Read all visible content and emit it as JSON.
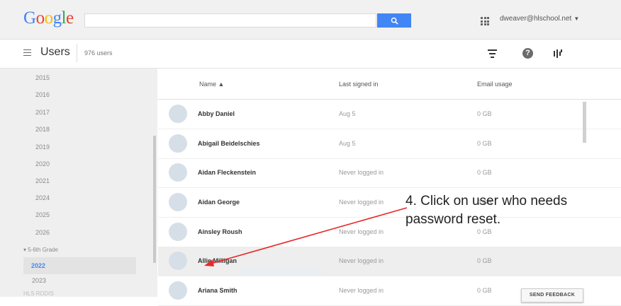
{
  "header": {
    "logo_letters": [
      "G",
      "o",
      "o",
      "g",
      "l",
      "e"
    ],
    "search_placeholder": "",
    "account": "dweaver@hlschool.net"
  },
  "page": {
    "title": "Users",
    "count": "976 users"
  },
  "sidebar": {
    "years": [
      "2015",
      "2016",
      "2017",
      "2018",
      "2019",
      "2020",
      "2021",
      "2024",
      "2025",
      "2026"
    ],
    "group": "▾ 5-6th Grade",
    "selected": "2022",
    "last_year": "2023",
    "next_group": "HLS RDDIS"
  },
  "table": {
    "headers": {
      "name": "Name ▲",
      "last_signed": "Last signed in",
      "email_usage": "Email usage"
    },
    "rows": [
      {
        "name": "Abby Daniel",
        "last": "Aug 5",
        "usage": "0 GB"
      },
      {
        "name": "Abigail Beidelschies",
        "last": "Aug 5",
        "usage": "0 GB"
      },
      {
        "name": "Aidan Fleckenstein",
        "last": "Never logged in",
        "usage": "0 GB"
      },
      {
        "name": "Aidan George",
        "last": "Never logged in",
        "usage": "0 GB"
      },
      {
        "name": "Ainsley Roush",
        "last": "Never logged in",
        "usage": "0 GB"
      },
      {
        "name": "Allie Milligan",
        "last": "Never logged in",
        "usage": "0 GB"
      },
      {
        "name": "Ariana Smith",
        "last": "Never logged in",
        "usage": "0 GB"
      }
    ]
  },
  "annotation": {
    "line1": "4. Click on user who needs",
    "line2": "password reset."
  },
  "feedback": "SEND FEEDBACK",
  "colors": {
    "accent": "#4285f4",
    "arrow": "#e8282b"
  },
  "icons": [
    "search-icon",
    "apps-grid-icon",
    "menu-icon",
    "filter-icon",
    "help-icon",
    "columns-icon",
    "chevron-down-icon"
  ]
}
